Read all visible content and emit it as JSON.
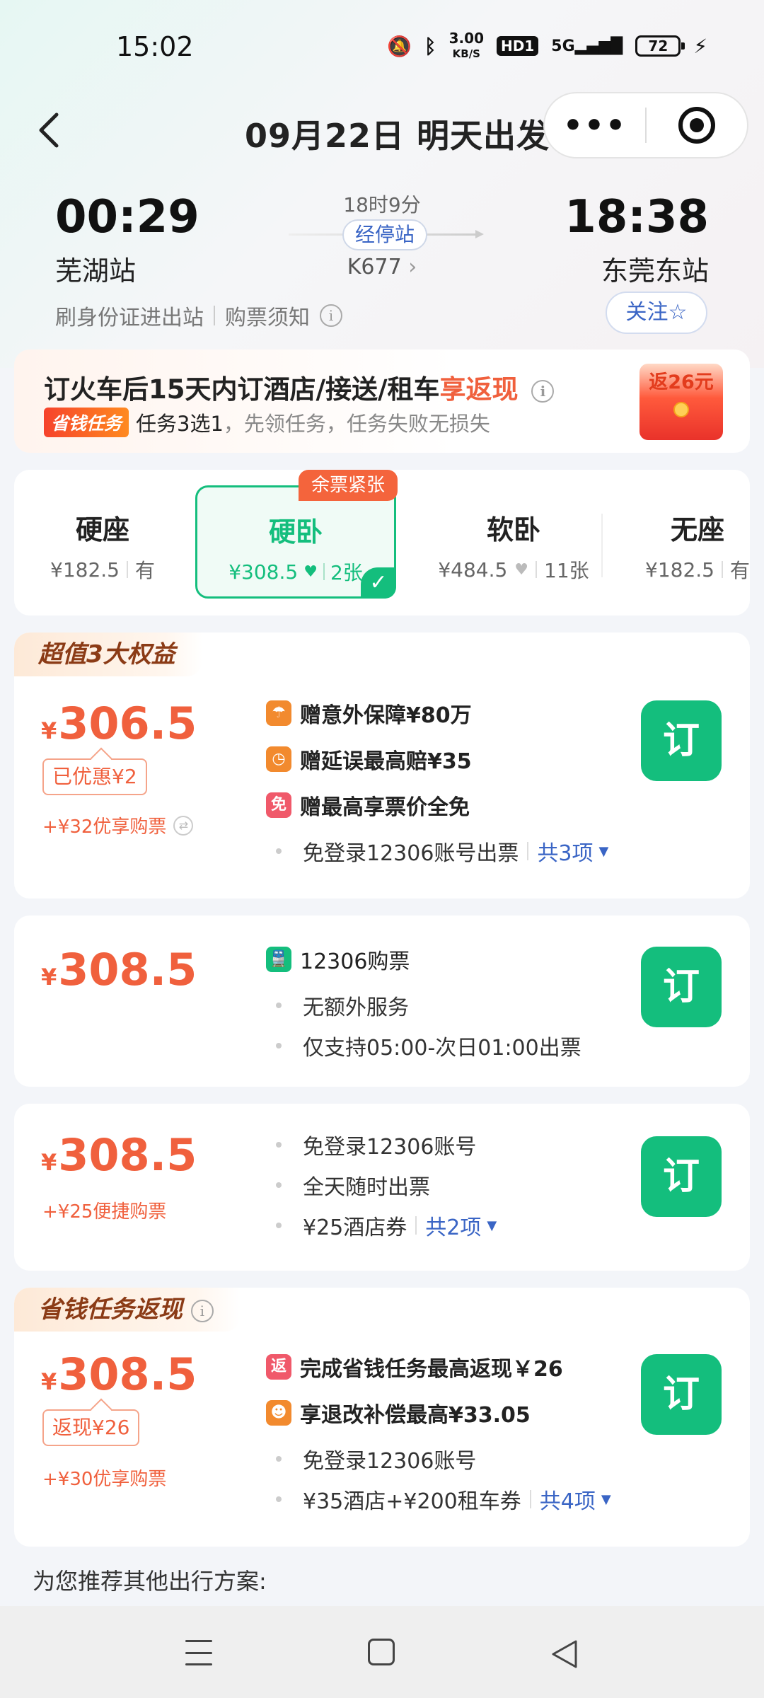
{
  "status_bar": {
    "time": "15:02",
    "net_speed_value": "3.00",
    "net_speed_unit": "KB/S",
    "hd": "HD1",
    "signal": "5G",
    "battery": "72"
  },
  "header": {
    "title": "09月22日 明天出发",
    "more_icon": "•••",
    "target_icon": "target-icon"
  },
  "train": {
    "departure_time": "00:29",
    "departure_station": "芜湖站",
    "arrival_time": "18:38",
    "arrival_station": "东莞东站",
    "duration": "18时9分",
    "stops_label": "经停站",
    "train_number": "K677",
    "id_entry": "刷身份证进出站",
    "ticket_notice": "购票须知",
    "follow_label": "关注"
  },
  "promo": {
    "title_prefix": "订火车后15天内订酒店/接送/租车",
    "title_highlight": "享返现",
    "badge": "省钱任务",
    "sub_strong": "任务3选1",
    "sub_rest": "，先领任务，任务失败无损失",
    "redpacket_text": "返26元"
  },
  "seats": {
    "scarce_tag": "余票紧张",
    "items": [
      {
        "name": "硬座",
        "price": "¥182.5",
        "avail": "有"
      },
      {
        "name": "硬卧",
        "price": "¥308.5",
        "avail": "2张"
      },
      {
        "name": "软卧",
        "price": "¥484.5",
        "avail": "11张"
      },
      {
        "name": "无座",
        "price": "¥182.5",
        "avail": "有"
      }
    ]
  },
  "offers": [
    {
      "tag": "超值3大权益",
      "yen": "¥",
      "price": "306.5",
      "discount": "已优惠¥2",
      "note": "+¥32优享购票",
      "benefits": [
        "赠意外保障¥80万",
        "赠延误最高赔¥35",
        "赠最高享票价全免"
      ],
      "benefit_icons": [
        "umbrella-icon",
        "clock-icon",
        "免"
      ],
      "bullets": [
        "免登录12306账号出票"
      ],
      "more": "共3项",
      "book": "订"
    },
    {
      "yen": "¥",
      "price": "308.5",
      "benefits": [
        "12306购票"
      ],
      "benefit_icons": [
        "train-icon"
      ],
      "bullets": [
        "无额外服务",
        "仅支持05:00-次日01:00出票"
      ],
      "book": "订"
    },
    {
      "yen": "¥",
      "price": "308.5",
      "note": "+¥25便捷购票",
      "bullets": [
        "免登录12306账号",
        "全天随时出票",
        "¥25酒店券"
      ],
      "more": "共2项",
      "book": "订"
    },
    {
      "tag": "省钱任务返现",
      "yen": "¥",
      "price": "308.5",
      "discount": "返现¥26",
      "note": "+¥30优享购票",
      "benefits": [
        "完成省钱任务最高返现￥26",
        "享退改补偿最高¥33.05"
      ],
      "benefit_icons": [
        "返",
        "refund-icon"
      ],
      "bullets": [
        "免登录12306账号",
        "¥35酒店+¥200租车券"
      ],
      "more": "共4项",
      "book": "订"
    }
  ],
  "recommend_label": "为您推荐其他出行方案:",
  "colors": {
    "accent_green": "#14be7d",
    "price_orange": "#f0603d",
    "link_blue": "#3a65c5"
  }
}
